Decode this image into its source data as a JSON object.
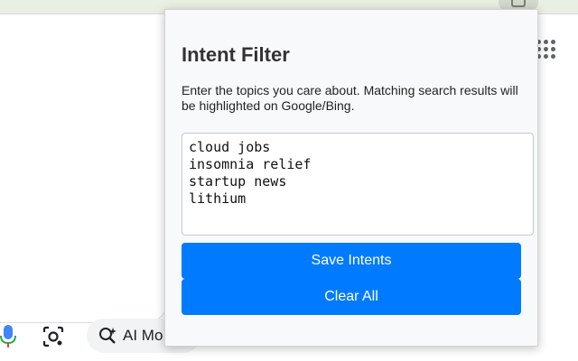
{
  "popup": {
    "title": "Intent Filter",
    "description": "Enter the topics you care about. Matching search results will be highlighted on Google/Bing.",
    "intents_text": "cloud jobs\ninsomnia relief\nstartup news\nlithium",
    "save_label": "Save Intents",
    "clear_label": "Clear All",
    "accent": "#007bff"
  },
  "page": {
    "ai_mode_label": "AI Mo"
  },
  "icons": [
    "mic-icon",
    "lens-icon",
    "ai-mode-icon",
    "apps-grid-icon",
    "extension-icon"
  ]
}
